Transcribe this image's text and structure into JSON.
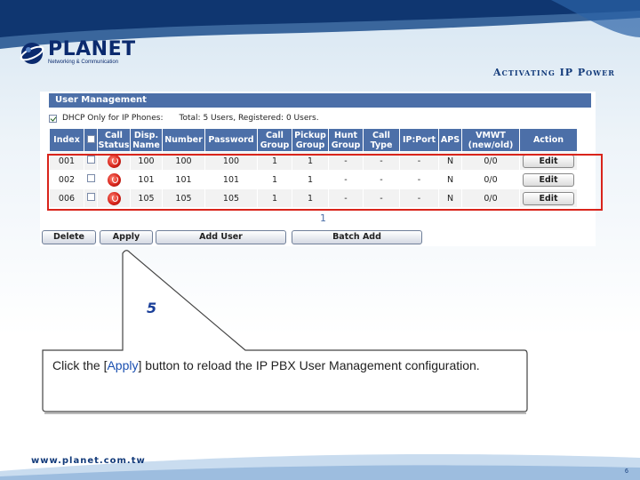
{
  "slide": {
    "logo_name": "PLANET",
    "logo_tagline": "Networking & Communication",
    "tagline": "Activating IP Power",
    "footer_url": "www.planet.com.tw",
    "page_number": "6"
  },
  "panel": {
    "title": "User Management",
    "dhcp_label": "DHCP Only for IP Phones:",
    "dhcp_checked": true,
    "summary": "Total: 5 Users, Registered: 0 Users.",
    "columns": [
      "Index",
      "",
      "Call Status",
      "Disp. Name",
      "Number",
      "Password",
      "Call Group",
      "Pickup Group",
      "Hunt Group",
      "Call Type",
      "IP:Port",
      "APS",
      "VMWT (new/old)",
      "Action"
    ],
    "rows": [
      {
        "index": "001",
        "disp_name": "100",
        "number": "100",
        "password": "100",
        "call_group": "1",
        "pickup_group": "1",
        "hunt_group": "-",
        "call_type": "-",
        "ip_port": "-",
        "aps": "N",
        "vmwt": "0/0",
        "action": "Edit"
      },
      {
        "index": "002",
        "disp_name": "101",
        "number": "101",
        "password": "101",
        "call_group": "1",
        "pickup_group": "1",
        "hunt_group": "-",
        "call_type": "-",
        "ip_port": "-",
        "aps": "N",
        "vmwt": "0/0",
        "action": "Edit"
      },
      {
        "index": "006",
        "disp_name": "105",
        "number": "105",
        "password": "105",
        "call_group": "1",
        "pickup_group": "1",
        "hunt_group": "-",
        "call_type": "-",
        "ip_port": "-",
        "aps": "N",
        "vmwt": "0/0",
        "action": "Edit"
      }
    ],
    "pagination": "1",
    "buttons": {
      "delete": "Delete",
      "apply": "Apply",
      "add_user": "Add User",
      "batch_add": "Batch Add"
    }
  },
  "callout": {
    "step": "5",
    "text_before": "Click the [",
    "text_highlight": "Apply",
    "text_after": "] button to reload the IP PBX User Management configuration."
  },
  "colors": {
    "header_blue": "#4c6fa8",
    "highlight_red": "#d9241b",
    "callout_border": "#444444",
    "brand_navy": "#0b2a6e"
  }
}
